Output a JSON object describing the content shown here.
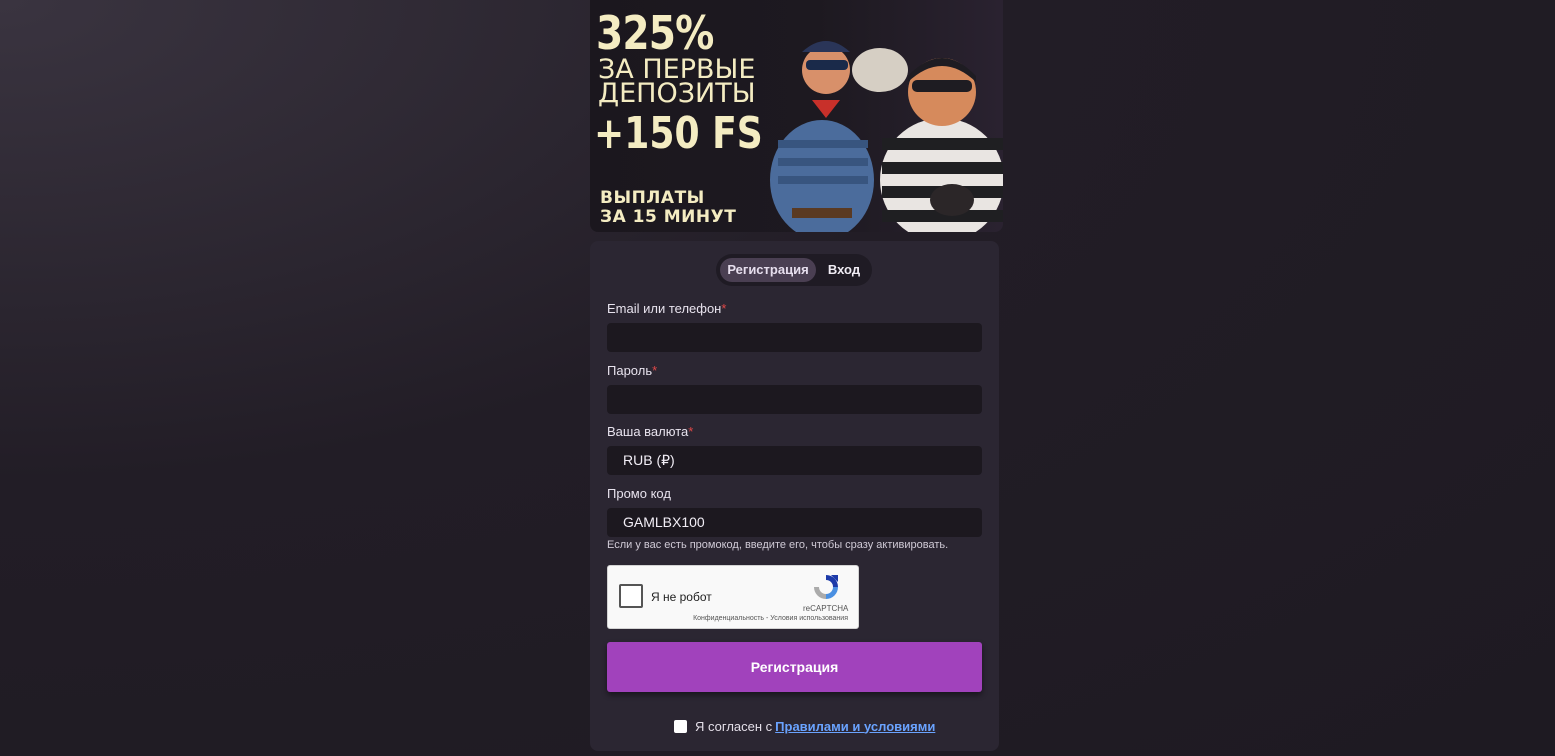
{
  "banner": {
    "percent": "325%",
    "line1": "ЗА ПЕРВЫЕ",
    "line2": "ДЕПОЗИТЫ",
    "freespins": "+150 FS",
    "payout1": "ВЫПЛАТЫ",
    "payout2": "ЗА 15 МИНУТ"
  },
  "tabs": {
    "register": "Регистрация",
    "login": "Вход"
  },
  "form": {
    "email_label": "Email или телефон",
    "password_label": "Пароль",
    "currency_label": "Ваша валюта",
    "currency_value": "RUB (₽)",
    "promo_label": "Промо код",
    "promo_value": "GAMLBX100",
    "promo_hint": "Если у вас есть промокод, введите его, чтобы сразу активировать.",
    "required_mark": "*"
  },
  "captcha": {
    "label": "Я не робот",
    "brand": "reCAPTCHA",
    "links": "Конфиденциальность - Условия использования"
  },
  "submit_label": "Регистрация",
  "agreement": {
    "text": "Я согласен с",
    "link": "Правилами и условиями"
  },
  "colors": {
    "accent": "#a142bc",
    "link": "#6aa3ff",
    "required": "#e04848"
  }
}
